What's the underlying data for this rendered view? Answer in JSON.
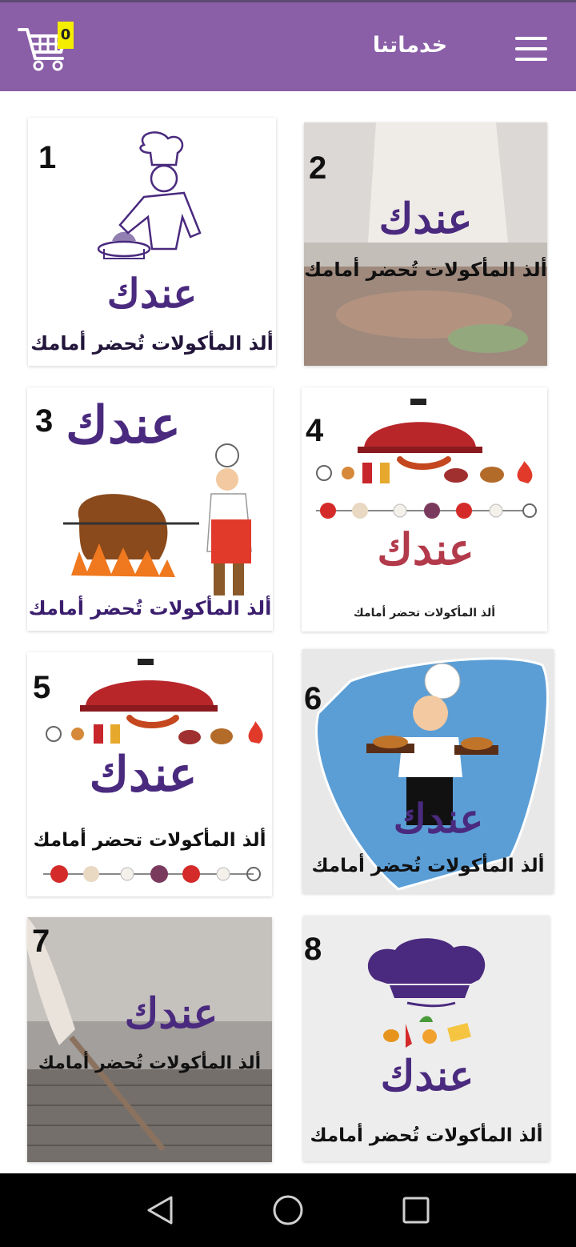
{
  "header": {
    "title": "خدماتنا",
    "cart_count": "0",
    "accent": "#8a5fa8"
  },
  "cards": [
    {
      "number": "1",
      "brand": "عندك",
      "slogan": "ألذ المأكولات تُحضر أمامك"
    },
    {
      "number": "2",
      "brand": "عندك",
      "slogan": "ألذ المأكولات تُحضر أمامك"
    },
    {
      "number": "3",
      "brand": "عندك",
      "slogan": "ألذ المأكولات تُحضر أمامك"
    },
    {
      "number": "4",
      "brand": "عندك",
      "slogan": "ألذ المأكولات تحضر أمامك"
    },
    {
      "number": "5",
      "brand": "عندك",
      "slogan": "ألذ المأكولات تحضر أمامك"
    },
    {
      "number": "6",
      "brand": "عندك",
      "slogan": "ألذ المأكولات تُحضر أمامك"
    },
    {
      "number": "7",
      "brand": "عندك",
      "slogan": "ألذ المأكولات تُحضر أمامك"
    },
    {
      "number": "8",
      "brand": "عندك",
      "slogan": "ألذ المأكولات تُحضر أمامك"
    }
  ],
  "navigation": {
    "back_icon": "triangle-back-icon",
    "home_icon": "circle-home-icon",
    "recents_icon": "square-recents-icon"
  }
}
